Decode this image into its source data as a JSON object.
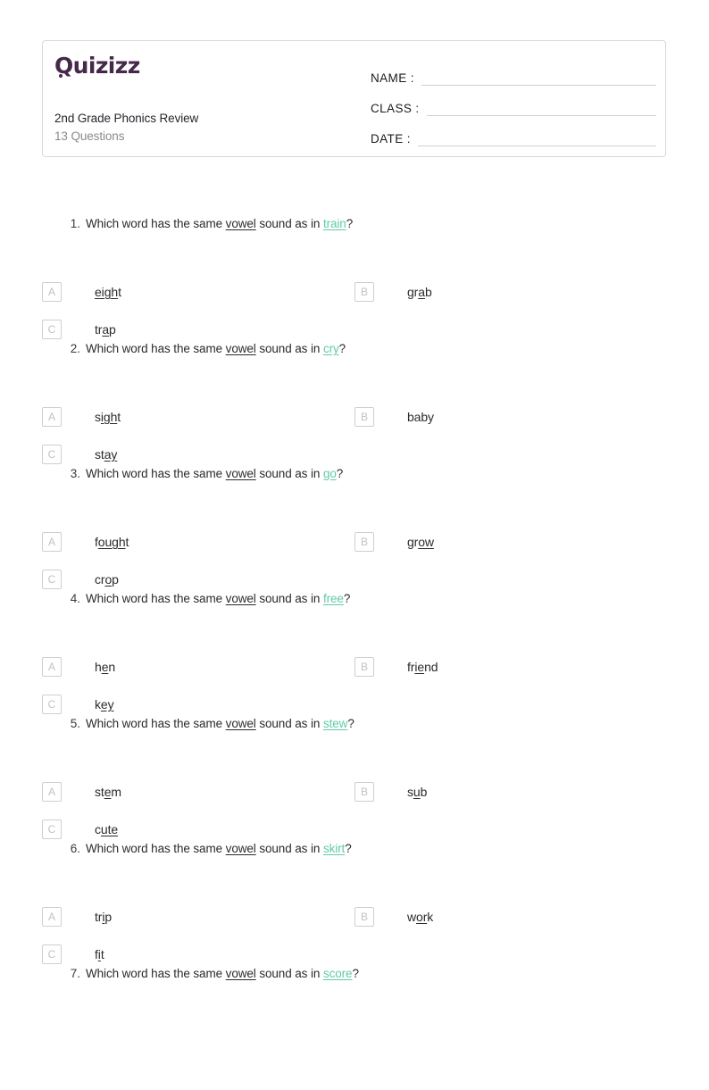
{
  "header": {
    "logo_text": "Quizizz",
    "logo_color": "#46284a",
    "title": "2nd Grade Phonics Review",
    "subtitle": "13 Questions",
    "fields": [
      {
        "label": "NAME :",
        "value": ""
      },
      {
        "label": "CLASS :",
        "value": ""
      },
      {
        "label": "DATE  :",
        "value": ""
      }
    ]
  },
  "style": {
    "accent_green": "#5fcaa8",
    "letter_box_border": "#cfcfcf",
    "letter_box_text": "#c2c2c2"
  },
  "questions": [
    {
      "number": "1.",
      "prefix": "Which word has the same ",
      "emphasis": "vowel",
      "middle": " sound as in ",
      "target": "train",
      "target_underline": "train",
      "suffix": "?",
      "options": [
        {
          "letter": "A",
          "pre": "",
          "mark": "eigh",
          "post": "t"
        },
        {
          "letter": "B",
          "pre": "gr",
          "mark": "a",
          "post": "b"
        },
        {
          "letter": "C",
          "pre": "tr",
          "mark": "a",
          "post": "p"
        }
      ]
    },
    {
      "number": "2.",
      "prefix": "Which word has the same ",
      "emphasis": "vowel",
      "middle": " sound as in ",
      "target": "cry",
      "target_underline": "cry",
      "suffix": "?",
      "options": [
        {
          "letter": "A",
          "pre": "s",
          "mark": "igh",
          "post": "t"
        },
        {
          "letter": "B",
          "pre": "baby",
          "mark": "",
          "post": ""
        },
        {
          "letter": "C",
          "pre": "st",
          "mark": "ay",
          "post": ""
        }
      ]
    },
    {
      "number": "3.",
      "prefix": "Which word has the same ",
      "emphasis": "vowel",
      "middle": " sound as in ",
      "target": "go",
      "target_underline": "o",
      "suffix": "?",
      "options": [
        {
          "letter": "A",
          "pre": "f",
          "mark": "ough",
          "post": "t"
        },
        {
          "letter": "B",
          "pre": "gr",
          "mark": "ow",
          "post": ""
        },
        {
          "letter": "C",
          "pre": "cr",
          "mark": "o",
          "post": "p"
        }
      ]
    },
    {
      "number": "4.",
      "prefix": "Which word has the same ",
      "emphasis": "vowel",
      "middle": " sound as in ",
      "target": "free",
      "target_underline": "ree",
      "suffix": "?",
      "options": [
        {
          "letter": "A",
          "pre": "h",
          "mark": "e",
          "post": "n"
        },
        {
          "letter": "B",
          "pre": "fr",
          "mark": "ie",
          "post": "nd"
        },
        {
          "letter": "C",
          "pre": "k",
          "mark": "ey",
          "post": ""
        }
      ]
    },
    {
      "number": "5.",
      "prefix": "Which word has the same ",
      "emphasis": "vowel",
      "middle": " sound as in ",
      "target": "stew",
      "target_underline": "stew",
      "suffix": "?",
      "options": [
        {
          "letter": "A",
          "pre": "st",
          "mark": "e",
          "post": "m"
        },
        {
          "letter": "B",
          "pre": "s",
          "mark": "u",
          "post": "b"
        },
        {
          "letter": "C",
          "pre": "c",
          "mark": "ute",
          "post": ""
        }
      ]
    },
    {
      "number": "6.",
      "prefix": "Which word has the same ",
      "emphasis": "vowel",
      "middle": " sound as in ",
      "target": "skirt",
      "target_underline": "skirt",
      "suffix": "?",
      "options": [
        {
          "letter": "A",
          "pre": "tr",
          "mark": "i",
          "post": "p"
        },
        {
          "letter": "B",
          "pre": "w",
          "mark": "or",
          "post": "k"
        },
        {
          "letter": "C",
          "pre": "f",
          "mark": "i",
          "post": "t"
        }
      ]
    },
    {
      "number": "7.",
      "prefix": "Which word has the same ",
      "emphasis": "vowel",
      "middle": " sound as in ",
      "target": "score",
      "target_underline": "score",
      "suffix": "?",
      "options": []
    }
  ]
}
